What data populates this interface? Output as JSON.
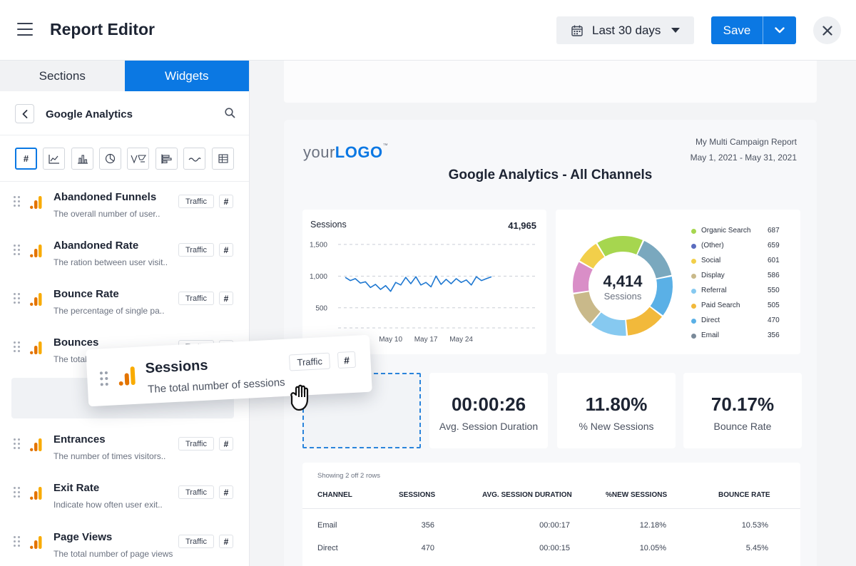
{
  "header": {
    "title": "Report Editor",
    "date_range": "Last 30 days",
    "save_label": "Save"
  },
  "sidebar": {
    "tabs": [
      {
        "label": "Sections",
        "active": false
      },
      {
        "label": "Widgets",
        "active": true
      }
    ],
    "source_title": "Google Analytics",
    "widget_types": [
      "number",
      "line-chart",
      "bar-chart",
      "pie-chart",
      "funnel",
      "horizontal-bar",
      "sparkline",
      "table"
    ],
    "number_type_label": "#",
    "metrics": [
      {
        "name": "Abandoned Funnels",
        "desc": "The overall number of user..",
        "chip": "Traffic",
        "hash": "#"
      },
      {
        "name": "Abandoned Rate",
        "desc": "The ration between user visit..",
        "chip": "Traffic",
        "hash": "#"
      },
      {
        "name": "Bounce Rate",
        "desc": "The percentage of single pa..",
        "chip": "Traffic",
        "hash": "#"
      },
      {
        "name": "Bounces",
        "desc": "The total",
        "chip": "Traffic",
        "hash": "#"
      },
      {
        "name": "Entrances",
        "desc": "The number of times visitors..",
        "chip": "Traffic",
        "hash": "#"
      },
      {
        "name": "Exit Rate",
        "desc": "Indicate how often user exit..",
        "chip": "Traffic",
        "hash": "#"
      },
      {
        "name": "Page Views",
        "desc": "The total number of page views",
        "chip": "Traffic",
        "hash": "#"
      }
    ]
  },
  "drag_card": {
    "name": "Sessions",
    "desc": "The total number of sessions",
    "chip": "Traffic",
    "hash": "#"
  },
  "report": {
    "logo_light": "your",
    "logo_bold": "LOGO",
    "logo_tm": "™",
    "name": "My Multi Campaign Report",
    "date_range": "May 1, 2021 - May 31, 2021",
    "title": "Google Analytics - All Channels",
    "kpis": [
      {
        "value": "00:00:26",
        "label": "Avg. Session Duration"
      },
      {
        "value": "11.80%",
        "label": "% New Sessions"
      },
      {
        "value": "70.17%",
        "label": "Bounce Rate"
      }
    ],
    "table": {
      "caption": "Showing 2 off 2 rows",
      "headers": [
        "CHANNEL",
        "SESSIONS",
        "AVG. SESSION DURATION",
        "%NEW SESSIONS",
        "BOUNCE RATE"
      ],
      "rows": [
        [
          "Email",
          "356",
          "00:00:17",
          "12.18%",
          "10.53%"
        ],
        [
          "Direct",
          "470",
          "00:00:15",
          "10.05%",
          "5.45%"
        ]
      ]
    }
  },
  "chart_data": [
    {
      "type": "line",
      "title": "Sessions",
      "total": "41,965",
      "ylim": [
        250,
        1600
      ],
      "yticks": [
        500,
        1000,
        1500
      ],
      "ytick_labels": [
        "500",
        "1,000",
        "1,500"
      ],
      "xtick_labels": [
        "May 10",
        "May 17",
        "May 24"
      ],
      "xtick_days": [
        10,
        17,
        24
      ],
      "x": [
        1,
        2,
        3,
        4,
        5,
        6,
        7,
        8,
        9,
        10,
        11,
        12,
        13,
        14,
        15,
        16,
        17,
        18,
        19,
        20,
        21,
        22,
        23,
        24,
        25,
        26,
        27,
        28,
        29,
        30
      ],
      "y": [
        980,
        930,
        960,
        890,
        910,
        820,
        870,
        790,
        850,
        760,
        900,
        860,
        980,
        880,
        990,
        860,
        900,
        830,
        1000,
        870,
        950,
        880,
        960,
        900,
        940,
        860,
        990,
        930,
        960,
        990
      ],
      "grid": true,
      "color": "#1f78d1"
    },
    {
      "type": "pie",
      "donut": true,
      "center_value": "4,414",
      "center_label": "Sessions",
      "categories": [
        "Organic Search",
        "(Other)",
        "Social",
        "Display",
        "Referral",
        "Paid Search",
        "Direct",
        "Email"
      ],
      "values": [
        687,
        659,
        601,
        586,
        550,
        505,
        470,
        356
      ],
      "value_labels": [
        "687",
        "659",
        "601",
        "586",
        "550",
        "505",
        "470",
        "356"
      ],
      "colors": [
        "#a6d64f",
        "#7aa8be",
        "#5ab0e6",
        "#f2b93b",
        "#86c9f0",
        "#c9b98a",
        "#d98ec7",
        "#f2cf4a"
      ],
      "legend_colors": [
        "#a6d64f",
        "#5b6cbf",
        "#f2cf4a",
        "#c9b98a",
        "#86c9f0",
        "#f2b93b",
        "#5ab0e6",
        "#7a8a99"
      ],
      "legend": "right"
    }
  ]
}
